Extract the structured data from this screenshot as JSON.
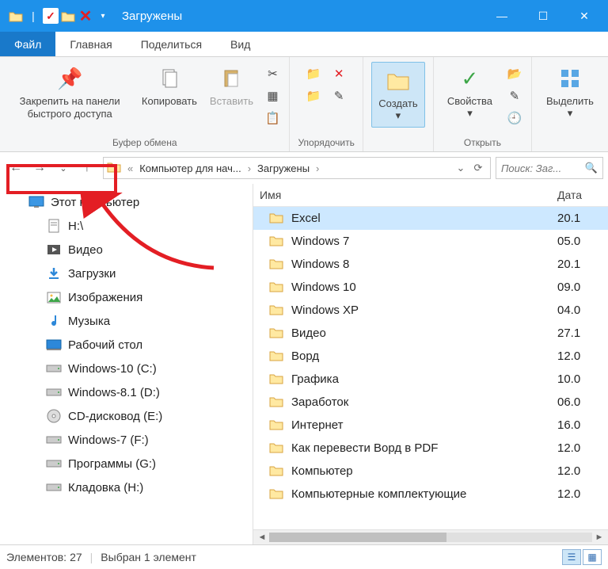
{
  "window": {
    "title": "Загружены"
  },
  "menu": {
    "file": "Файл",
    "home": "Главная",
    "share": "Поделиться",
    "view": "Вид"
  },
  "ribbon": {
    "pin": "Закрепить на панели быстрого доступа",
    "copy": "Копировать",
    "paste": "Вставить",
    "clipboard_label": "Буфер обмена",
    "organize_label": "Упорядочить",
    "create": "Создать",
    "properties": "Свойства",
    "open_label": "Открыть",
    "select": "Выделить"
  },
  "breadcrumb": {
    "item1": "Компьютер для нач...",
    "item2": "Загружены"
  },
  "search": {
    "placeholder": "Поиск: Заг..."
  },
  "tree": [
    {
      "label": "Этот компьютер",
      "icon": "monitor"
    },
    {
      "label": "H:\\",
      "icon": "doc"
    },
    {
      "label": "Видео",
      "icon": "video"
    },
    {
      "label": "Загрузки",
      "icon": "download"
    },
    {
      "label": "Изображения",
      "icon": "image"
    },
    {
      "label": "Музыка",
      "icon": "music"
    },
    {
      "label": "Рабочий стол",
      "icon": "desktop"
    },
    {
      "label": "Windows-10 (C:)",
      "icon": "drive"
    },
    {
      "label": "Windows-8.1 (D:)",
      "icon": "drive"
    },
    {
      "label": "CD-дисковод (E:)",
      "icon": "cd"
    },
    {
      "label": "Windows-7 (F:)",
      "icon": "drive"
    },
    {
      "label": "Программы (G:)",
      "icon": "drive"
    },
    {
      "label": "Кладовка (H:)",
      "icon": "drive"
    }
  ],
  "list": {
    "col_name": "Имя",
    "col_date": "Дата",
    "items": [
      {
        "name": "Excel",
        "date": "20.1",
        "selected": true
      },
      {
        "name": "Windows 7",
        "date": "05.0"
      },
      {
        "name": "Windows 8",
        "date": "20.1"
      },
      {
        "name": "Windows 10",
        "date": "09.0"
      },
      {
        "name": "Windows XP",
        "date": "04.0"
      },
      {
        "name": "Видео",
        "date": "27.1"
      },
      {
        "name": "Ворд",
        "date": "12.0"
      },
      {
        "name": "Графика",
        "date": "10.0"
      },
      {
        "name": "Заработок",
        "date": "06.0"
      },
      {
        "name": "Интернет",
        "date": "16.0"
      },
      {
        "name": "Как перевести Ворд в PDF",
        "date": "12.0"
      },
      {
        "name": "Компьютер",
        "date": "12.0"
      },
      {
        "name": "Компьютерные комплектующие",
        "date": "12.0"
      }
    ]
  },
  "status": {
    "elements_label": "Элементов:",
    "elements_count": "27",
    "selected_label": "Выбран 1 элемент"
  }
}
